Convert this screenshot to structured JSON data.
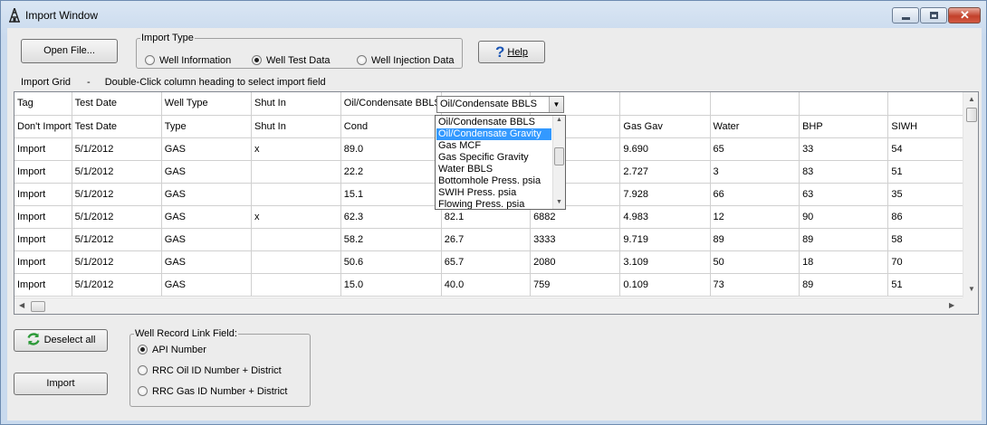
{
  "window": {
    "title": "Import Window"
  },
  "toolbar": {
    "open_file_label": "Open File...",
    "help_label": "Help"
  },
  "import_type": {
    "legend": "Import Type",
    "options": [
      {
        "label": "Well Information",
        "selected": false
      },
      {
        "label": "Well Test Data",
        "selected": true
      },
      {
        "label": "Well Injection Data",
        "selected": false
      }
    ]
  },
  "grid": {
    "caption": "Import Grid",
    "separator": "-",
    "hint": "Double-Click column heading to select import field",
    "header_row": [
      "Tag",
      "Test Date",
      "Well Type",
      "Shut In",
      "Oil/Condensate BBLS",
      "",
      "",
      "",
      "",
      "",
      ""
    ],
    "mapping_row": [
      "Don't Import",
      "Test Date",
      "Type",
      "Shut In",
      "Cond",
      "",
      "",
      "Gas Gav",
      "Water",
      "BHP",
      "SIWH"
    ],
    "rows": [
      [
        "Import",
        "5/1/2012",
        "GAS",
        "x",
        "89.0",
        "",
        "",
        "9.690",
        "65",
        "33",
        "54"
      ],
      [
        "Import",
        "5/1/2012",
        "GAS",
        "",
        "22.2",
        "",
        "",
        "2.727",
        "3",
        "83",
        "51"
      ],
      [
        "Import",
        "5/1/2012",
        "GAS",
        "",
        "15.1",
        "",
        "",
        "7.928",
        "66",
        "63",
        "35"
      ],
      [
        "Import",
        "5/1/2012",
        "GAS",
        "x",
        "62.3",
        "82.1",
        "6882",
        "4.983",
        "12",
        "90",
        "86"
      ],
      [
        "Import",
        "5/1/2012",
        "GAS",
        "",
        "58.2",
        "26.7",
        "3333",
        "9.719",
        "89",
        "89",
        "58"
      ],
      [
        "Import",
        "5/1/2012",
        "GAS",
        "",
        "50.6",
        "65.7",
        "2080",
        "3.109",
        "50",
        "18",
        "70"
      ],
      [
        "Import",
        "5/1/2012",
        "GAS",
        "",
        "15.0",
        "40.0",
        "759",
        "0.109",
        "73",
        "89",
        "51"
      ]
    ]
  },
  "field_combo": {
    "value": "Oil/Condensate BBLS",
    "options": [
      {
        "label": "Oil/Condensate BBLS",
        "selected": false
      },
      {
        "label": "Oil/Condensate Gravity",
        "selected": true
      },
      {
        "label": "Gas MCF",
        "selected": false
      },
      {
        "label": "Gas Specific Gravity",
        "selected": false
      },
      {
        "label": "Water BBLS",
        "selected": false
      },
      {
        "label": "Bottomhole Press. psia",
        "selected": false
      },
      {
        "label": "SWIH Press. psia",
        "selected": false
      },
      {
        "label": "Flowing Press. psia",
        "selected": false
      }
    ]
  },
  "bottom": {
    "deselect_label": "Deselect all",
    "import_label": "Import"
  },
  "link_field": {
    "legend": "Well Record Link Field:",
    "options": [
      {
        "label": "API Number",
        "selected": true
      },
      {
        "label": "RRC Oil ID Number + District",
        "selected": false
      },
      {
        "label": "RRC Gas ID Number + District",
        "selected": false
      }
    ]
  },
  "colors": {
    "selection": "#3399ff",
    "help_icon": "#1a55b5",
    "refresh_icon": "#2e9a3a"
  }
}
